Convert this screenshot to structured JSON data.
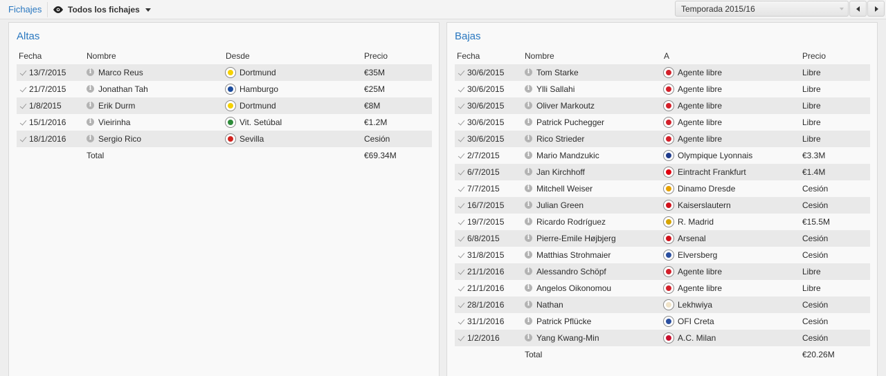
{
  "topbar": {
    "tab": "Fichajes",
    "view": "Todos los fichajes",
    "season": "Temporada 2015/16"
  },
  "altas": {
    "title": "Altas",
    "headers": {
      "fecha": "Fecha",
      "nombre": "Nombre",
      "club": "Desde",
      "precio": "Precio"
    },
    "rows": [
      {
        "fecha": "13/7/2015",
        "nombre": "Marco Reus",
        "club": "Dortmund",
        "precio": "€35M",
        "crest": "#f5d100"
      },
      {
        "fecha": "21/7/2015",
        "nombre": "Jonathan Tah",
        "club": "Hamburgo",
        "precio": "€25M",
        "crest": "#1d4c9c"
      },
      {
        "fecha": "1/8/2015",
        "nombre": "Erik Durm",
        "club": "Dortmund",
        "precio": "€8M",
        "crest": "#f5d100"
      },
      {
        "fecha": "15/1/2016",
        "nombre": "Vieirinha",
        "club": "Vit. Setúbal",
        "precio": "€1.2M",
        "crest": "#2e8b3a"
      },
      {
        "fecha": "18/1/2016",
        "nombre": "Sergio Rico",
        "club": "Sevilla",
        "precio": "Cesión",
        "crest": "#d0231f"
      }
    ],
    "total_label": "Total",
    "total_value": "€69.34M"
  },
  "bajas": {
    "title": "Bajas",
    "headers": {
      "fecha": "Fecha",
      "nombre": "Nombre",
      "club": "A",
      "precio": "Precio"
    },
    "rows": [
      {
        "fecha": "30/6/2015",
        "nombre": "Tom Starke",
        "club": "Agente libre",
        "precio": "Libre",
        "crest": "#d3202a"
      },
      {
        "fecha": "30/6/2015",
        "nombre": "Ylli Sallahi",
        "club": "Agente libre",
        "precio": "Libre",
        "crest": "#d3202a"
      },
      {
        "fecha": "30/6/2015",
        "nombre": "Oliver Markoutz",
        "club": "Agente libre",
        "precio": "Libre",
        "crest": "#d3202a"
      },
      {
        "fecha": "30/6/2015",
        "nombre": "Patrick Puchegger",
        "club": "Agente libre",
        "precio": "Libre",
        "crest": "#d3202a"
      },
      {
        "fecha": "30/6/2015",
        "nombre": "Rico Strieder",
        "club": "Agente libre",
        "precio": "Libre",
        "crest": "#d3202a"
      },
      {
        "fecha": "2/7/2015",
        "nombre": "Mario Mandzukic",
        "club": "Olympique Lyonnais",
        "precio": "€3.3M",
        "crest": "#1f3c8c"
      },
      {
        "fecha": "6/7/2015",
        "nombre": "Jan Kirchhoff",
        "club": "Eintracht Frankfurt",
        "precio": "€1.4M",
        "crest": "#e1000f"
      },
      {
        "fecha": "7/7/2015",
        "nombre": "Mitchell Weiser",
        "club": "Dinamo Dresde",
        "precio": "Cesión",
        "crest": "#e6a100"
      },
      {
        "fecha": "16/7/2015",
        "nombre": "Julian Green",
        "club": "Kaiserslautern",
        "precio": "Cesión",
        "crest": "#d0111b"
      },
      {
        "fecha": "19/7/2015",
        "nombre": "Ricardo Rodríguez",
        "club": "R. Madrid",
        "precio": "€15.5M",
        "crest": "#d6a400"
      },
      {
        "fecha": "6/8/2015",
        "nombre": "Pierre-Emile Højbjerg",
        "club": "Arsenal",
        "precio": "Cesión",
        "crest": "#d0111b"
      },
      {
        "fecha": "31/8/2015",
        "nombre": "Matthias Strohmaier",
        "club": "Elversberg",
        "precio": "Cesión",
        "crest": "#2a4fa0"
      },
      {
        "fecha": "21/1/2016",
        "nombre": "Alessandro Schöpf",
        "club": "Agente libre",
        "precio": "Libre",
        "crest": "#d3202a"
      },
      {
        "fecha": "21/1/2016",
        "nombre": "Angelos Oikonomou",
        "club": "Agente libre",
        "precio": "Libre",
        "crest": "#d3202a"
      },
      {
        "fecha": "28/1/2016",
        "nombre": "Nathan",
        "club": "Lekhwiya",
        "precio": "Cesión",
        "crest": "#f0e3c8"
      },
      {
        "fecha": "31/1/2016",
        "nombre": "Patrick Pflücke",
        "club": "OFI Creta",
        "precio": "Cesión",
        "crest": "#2a4fa0"
      },
      {
        "fecha": "1/2/2016",
        "nombre": "Yang Kwang-Min",
        "club": "A.C. Milan",
        "precio": "Cesión",
        "crest": "#c8102e"
      }
    ],
    "total_label": "Total",
    "total_value": "€20.26M"
  }
}
